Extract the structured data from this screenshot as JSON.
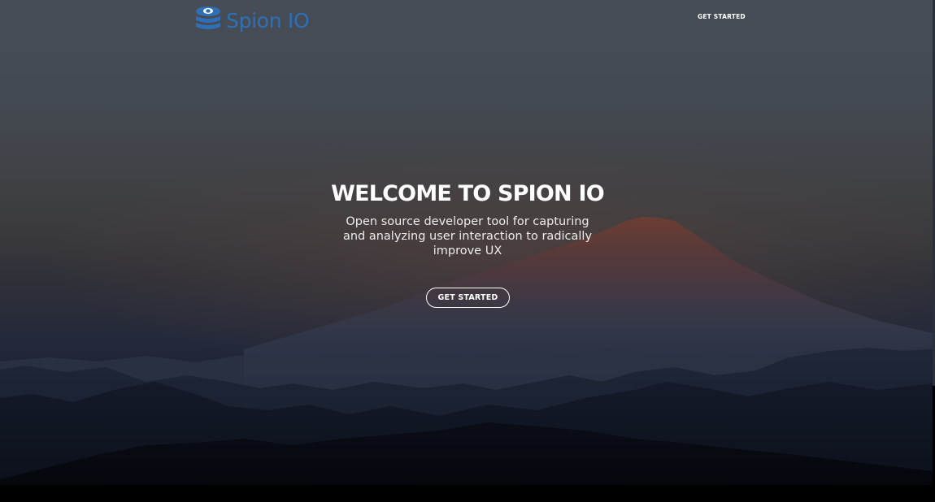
{
  "brand": {
    "name": "Spion IO",
    "logo_icon": "database-eye-icon",
    "logo_color": "#2e6fb8"
  },
  "nav": {
    "cta_label": "GET STARTED"
  },
  "hero": {
    "headline": "WELCOME TO SPION IO",
    "subtext": "Open source developer tool for capturing and analyzing user interaction to radically improve UX",
    "cta_label": "GET STARTED",
    "background": "mountain-sunset-image"
  },
  "colors": {
    "text": "#ffffff",
    "accent": "#2e6fb8"
  }
}
